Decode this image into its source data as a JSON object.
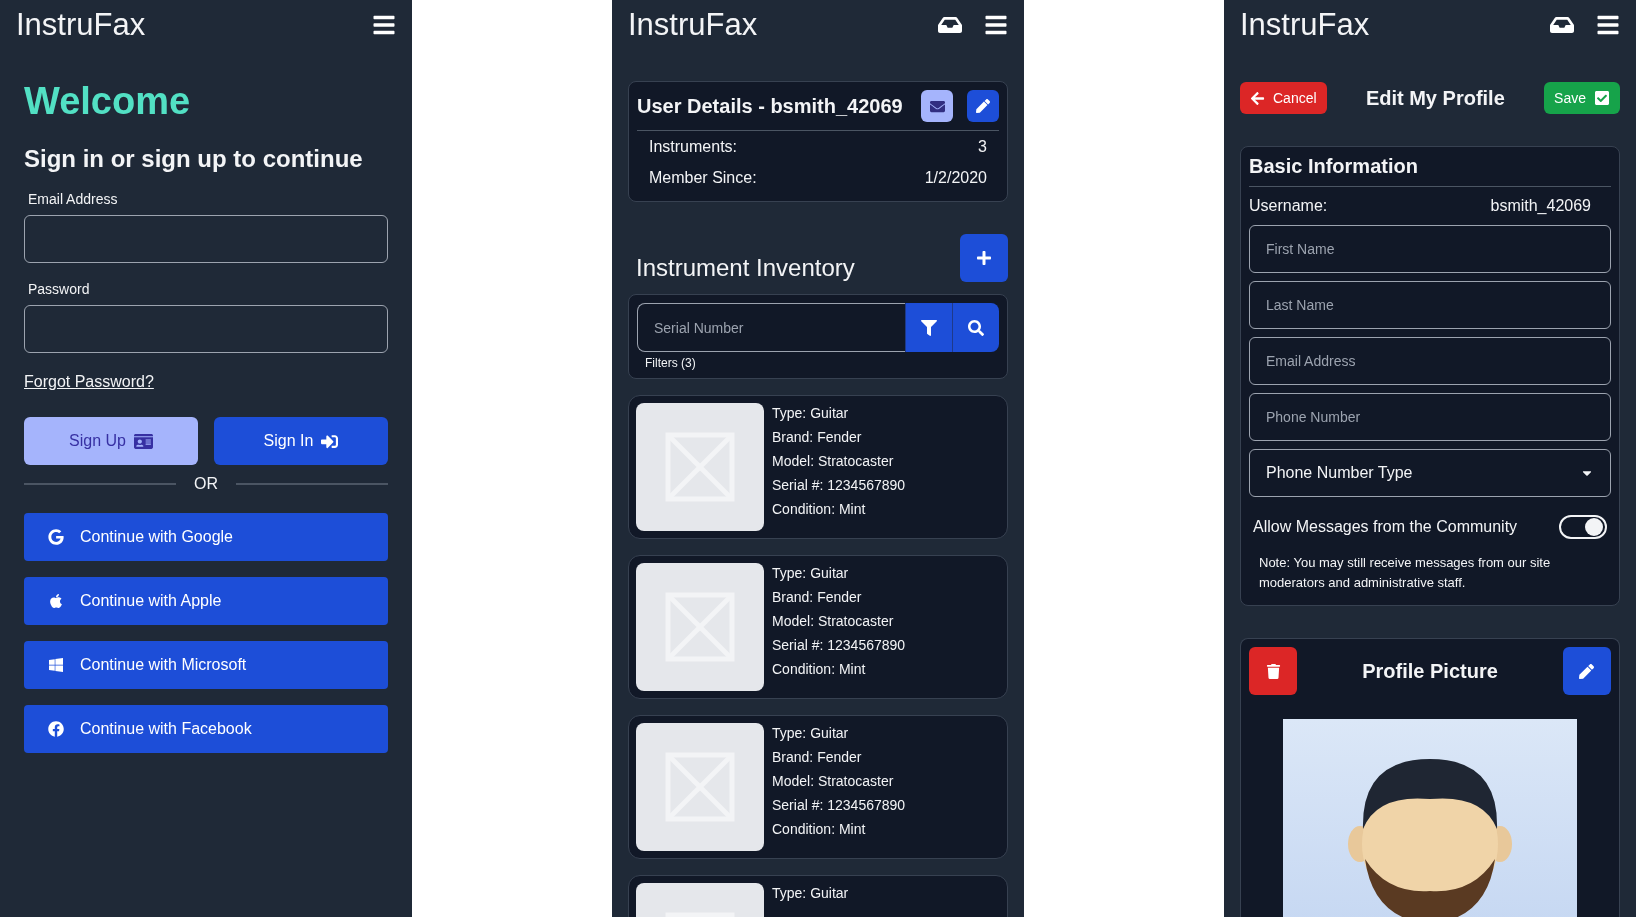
{
  "sign_in_screen": {
    "header": {
      "title": "InstruFax",
      "show_inbox": false
    },
    "welcome": "Welcome",
    "subtitle": "Sign in or sign up to continue",
    "fields": [
      {
        "label": "Email Address"
      },
      {
        "label": "Password"
      }
    ],
    "forgot_link": "Forgot Password?",
    "buttons": [
      {
        "label": "Sign Up",
        "kind": "secondary"
      },
      {
        "label": "Sign In",
        "kind": "primary"
      }
    ],
    "divider": "OR",
    "social_buttons": [
      {
        "label": "Continue with Google",
        "kind": "google"
      },
      {
        "label": "Continue with Apple",
        "kind": "apple"
      },
      {
        "label": "Continue with Microsoft",
        "kind": "microsoft"
      },
      {
        "label": "Continue with Facebook",
        "kind": "facebook"
      }
    ]
  },
  "profile_screen": {
    "header": {
      "title": "InstruFax",
      "show_inbox": true
    },
    "user_details": {
      "title": "User Details - bsmith_42069",
      "rows": [
        {
          "label": "Instruments:",
          "value": "3"
        },
        {
          "label": "Member Since:",
          "value": "1/2/2020"
        }
      ]
    },
    "inventory": {
      "title": "Instrument Inventory",
      "search": {
        "placeholder": "Serial Number"
      },
      "filters": "Filters (3)",
      "items": [
        {
          "lines": [
            "Type: Guitar",
            "Brand: Fender",
            "Model: Stratocaster",
            "Serial #: 1234567890",
            "Condition: Mint"
          ]
        },
        {
          "lines": [
            "Type: Guitar",
            "Brand: Fender",
            "Model: Stratocaster",
            "Serial #: 1234567890",
            "Condition: Mint"
          ]
        },
        {
          "lines": [
            "Type: Guitar",
            "Brand: Fender",
            "Model: Stratocaster",
            "Serial #: 1234567890",
            "Condition: Mint"
          ]
        },
        {
          "lines": [
            "Type: Guitar"
          ]
        }
      ]
    }
  },
  "edit_profile_screen": {
    "header": {
      "title": "InstruFax",
      "show_inbox": true
    },
    "cancel": "Cancel",
    "title": "Edit My Profile",
    "save": "Save",
    "basic_information": {
      "title": "Basic Information",
      "username_label": "Username:",
      "username": "bsmith_42069",
      "fields": [
        {
          "placeholder": "First Name"
        },
        {
          "placeholder": "Last Name"
        },
        {
          "placeholder": "Email Address"
        },
        {
          "placeholder": "Phone Number"
        }
      ],
      "phone_type": "Phone Number Type",
      "allow_messages": {
        "label": "Allow Messages from the Community",
        "on": true
      },
      "note": "Note: You may still receive messages from our site moderators and administrative staff."
    },
    "profile_picture": {
      "title": "Profile Picture"
    }
  }
}
